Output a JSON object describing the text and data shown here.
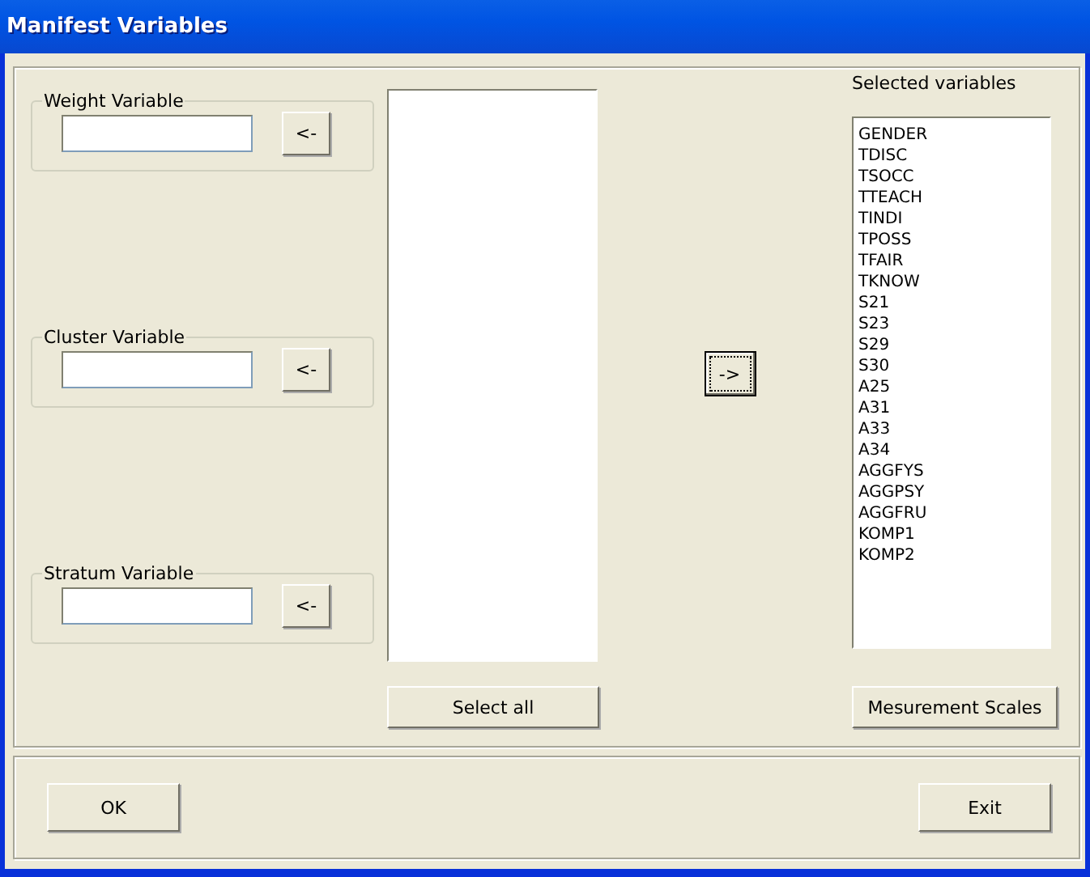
{
  "window": {
    "title": "Manifest Variables"
  },
  "variable_groups": [
    {
      "label": "Weight Variable",
      "button": "<-"
    },
    {
      "label": "Cluster Variable",
      "button": "<-"
    },
    {
      "label": "Stratum Variable",
      "button": "<-"
    }
  ],
  "available_list": {
    "button": "Select all"
  },
  "move_button": "->",
  "selected_list": {
    "label": "Selected variables",
    "items": [
      "GENDER",
      "TDISC",
      "TSOCC",
      "TTEACH",
      "TINDI",
      "TPOSS",
      "TFAIR",
      "TKNOW",
      "S21",
      "S23",
      "S29",
      "S30",
      "A25",
      "A31",
      "A33",
      "A34",
      "AGGFYS",
      "AGGPSY",
      "AGGFRU",
      "KOMP1",
      "KOMP2"
    ],
    "button": "Mesurement Scales"
  },
  "footer_buttons": [
    "OK",
    "Exit"
  ]
}
